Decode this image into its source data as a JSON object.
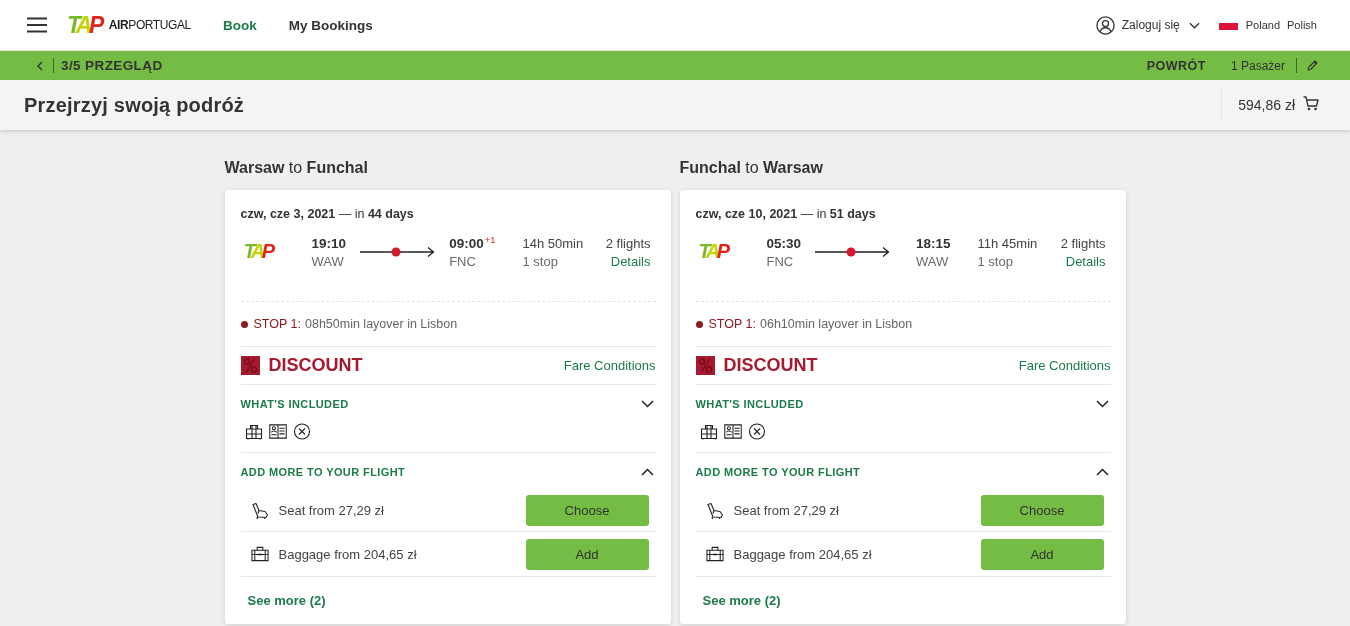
{
  "header": {
    "logo": {
      "mark": "TAP",
      "wordmark": "**AIR**PORTUGAL"
    },
    "nav": [
      {
        "label": "Book",
        "selected": true
      },
      {
        "label": "My Bookings",
        "selected": false
      }
    ],
    "login": "Zaloguj się",
    "country": "Poland",
    "language": "Polish"
  },
  "step_bar": {
    "step": "3/5 PRZEGLĄD",
    "trip_type": "POWRÓT",
    "passengers": "1 Pasażer"
  },
  "title_bar": {
    "title": "Przejrzyj swoją podróż",
    "total": "594,86 zł"
  },
  "journeys": [
    {
      "heading": "**Warsaw** to **Funchal**",
      "date": "**czw, cze 3, 2021** — in **44 days**",
      "airline_logo": "TAP",
      "departure": {
        "time": "19:10",
        "airport": "WAW"
      },
      "arrival": {
        "time": "09:00",
        "day_offset": "+1",
        "airport": "FNC"
      },
      "duration": "14h 50min",
      "stops": "1 stop",
      "flights": "2 flights",
      "details_link": "Details",
      "layover": {
        "label": "STOP 1:",
        "text": "08h50min layover in Lisbon"
      },
      "fare": {
        "name": "DISCOUNT",
        "conditions_link": "Fare Conditions"
      },
      "included": {
        "title": "WHAT'S INCLUDED",
        "expanded": false
      },
      "extras": {
        "title": "ADD MORE TO YOUR FLIGHT",
        "expanded": true,
        "items": [
          {
            "kind": "seat",
            "text": "Seat from 27,29 zł",
            "button": "Choose"
          },
          {
            "kind": "baggage",
            "text": "Baggage from 204,65 zł",
            "button": "Add"
          }
        ],
        "see_more": "See more (2)"
      }
    },
    {
      "heading": "**Funchal** to **Warsaw**",
      "date": "**czw, cze 10, 2021** — in **51 days**",
      "airline_logo": "TAP",
      "departure": {
        "time": "05:30",
        "airport": "FNC"
      },
      "arrival": {
        "time": "18:15",
        "airport": "WAW"
      },
      "duration": "11h 45min",
      "stops": "1 stop",
      "flights": "2 flights",
      "details_link": "Details",
      "layover": {
        "label": "STOP 1:",
        "text": "06h10min layover in Lisbon"
      },
      "fare": {
        "name": "DISCOUNT",
        "conditions_link": "Fare Conditions"
      },
      "included": {
        "title": "WHAT'S INCLUDED",
        "expanded": false
      },
      "extras": {
        "title": "ADD MORE TO YOUR FLIGHT",
        "expanded": true,
        "items": [
          {
            "kind": "seat",
            "text": "Seat from 27,29 zł",
            "button": "Choose"
          },
          {
            "kind": "baggage",
            "text": "Baggage from 204,65 zł",
            "button": "Add"
          }
        ],
        "see_more": "See more (2)"
      }
    }
  ]
}
